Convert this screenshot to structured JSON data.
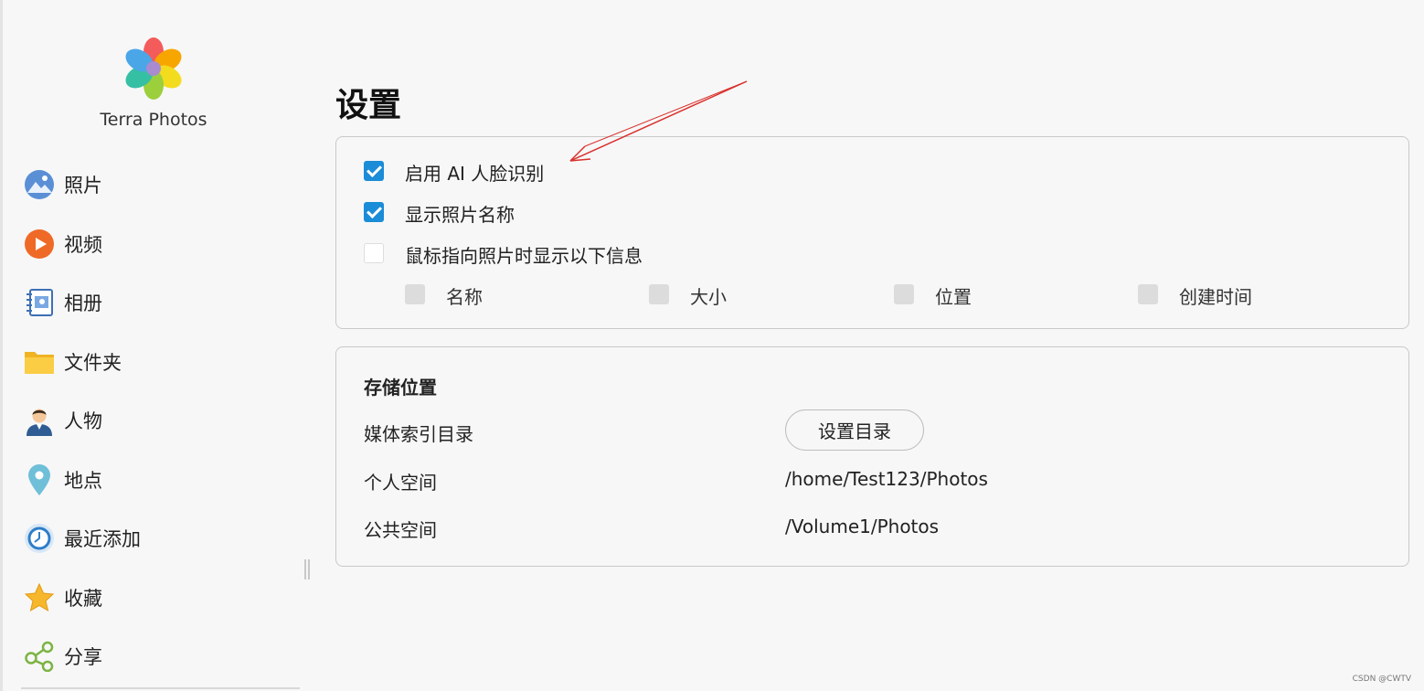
{
  "app": {
    "name": "Terra Photos"
  },
  "sidebar": {
    "items": [
      {
        "label": "照片",
        "icon": "photos-icon"
      },
      {
        "label": "视频",
        "icon": "video-play-icon"
      },
      {
        "label": "相册",
        "icon": "album-icon"
      },
      {
        "label": "文件夹",
        "icon": "folder-icon"
      },
      {
        "label": "人物",
        "icon": "person-icon"
      },
      {
        "label": "地点",
        "icon": "location-pin-icon"
      },
      {
        "label": "最近添加",
        "icon": "clock-icon"
      },
      {
        "label": "收藏",
        "icon": "star-icon"
      },
      {
        "label": "分享",
        "icon": "share-icon"
      }
    ]
  },
  "settings": {
    "title": "设置",
    "options": [
      {
        "label": "启用 AI 人脸识别",
        "checked": true
      },
      {
        "label": "显示照片名称",
        "checked": true
      },
      {
        "label": "鼠标指向照片时显示以下信息",
        "checked": false
      }
    ],
    "hover_fields": [
      {
        "label": "名称",
        "checked": false
      },
      {
        "label": "大小",
        "checked": false
      },
      {
        "label": "位置",
        "checked": false
      },
      {
        "label": "创建时间",
        "checked": false
      }
    ]
  },
  "storage": {
    "title": "存储位置",
    "media_index_label": "媒体索引目录",
    "set_dir_button": "设置目录",
    "personal_label": "个人空间",
    "personal_path": "/home/Test123/Photos",
    "public_label": "公共空间",
    "public_path": "/Volume1/Photos"
  },
  "watermark": "CSDN @CWTV",
  "colors": {
    "accent": "#1a8cd8",
    "annotation_arrow": "#d9302c"
  }
}
